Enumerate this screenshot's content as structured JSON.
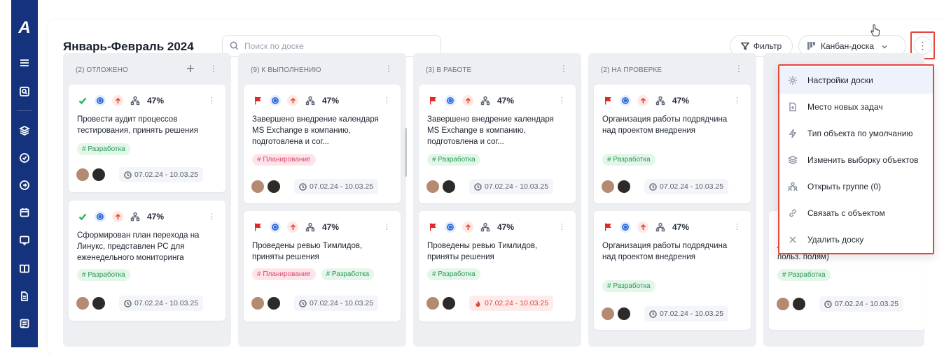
{
  "board": {
    "title": "Январь-Февраль 2024",
    "search_placeholder": "Поиск по доске",
    "filter_label": "Фильтр",
    "view_label": "Канбан-доска"
  },
  "columns": [
    {
      "header": "(2) ОТЛОЖЕНО",
      "cards": [
        {
          "status": "check",
          "percent": "47%",
          "title": "Провести аудит процессов тестирования, принять решения",
          "tags": [
            "# Разработка"
          ],
          "date": "07.02.24 - 10.03.25",
          "overdue": false
        },
        {
          "status": "check",
          "percent": "47%",
          "title": "Сформирован план перехода на Линукс, представлен PC для еженедельного мониторинга",
          "tags": [
            "# Разработка"
          ],
          "date": "07.02.24 - 10.03.25",
          "overdue": false
        }
      ]
    },
    {
      "header": "(9) К ВЫПОЛНЕНИЮ",
      "cards": [
        {
          "status": "flag",
          "percent": "47%",
          "title": "Завершено внедрение календаря MS Exchange в компанию, подготовлена и сог...",
          "tags": [
            "# Планирование"
          ],
          "date": "07.02.24 - 10.03.25",
          "overdue": false
        },
        {
          "status": "flag",
          "percent": "47%",
          "title": "Проведены ревью Тимлидов, приняты решения",
          "tags": [
            "# Планирование",
            "# Разработка"
          ],
          "date": "07.02.24 - 10.03.25",
          "overdue": false
        }
      ]
    },
    {
      "header": "(3) В РАБОТЕ",
      "cards": [
        {
          "status": "flag",
          "percent": "47%",
          "title": "Завершено внедрение календаря MS Exchange в компанию, подготовлена и сог...",
          "tags": [
            "# Разработка"
          ],
          "date": "07.02.24 - 10.03.25",
          "overdue": false
        },
        {
          "status": "flag",
          "percent": "47%",
          "title": "Проведены ревью Тимлидов, приняты решения",
          "tags": [
            "# Разработка"
          ],
          "date": "07.02.24 - 10.03.25",
          "overdue": true
        }
      ]
    },
    {
      "header": "(2) НА ПРОВЕРКЕ",
      "cards": [
        {
          "status": "flag",
          "percent": "47%",
          "title": "Организация работы подрядчина над проектом внедрения",
          "tags": [
            "# Разработка"
          ],
          "date": "07.02.24 - 10.03.25",
          "overdue": false
        },
        {
          "status": "flag",
          "percent": "47%",
          "title": "Организация работы подрядчина над проектом внедрения",
          "tags": [
            "# Разработка"
          ],
          "date": "07.02.24 - 10.03.25",
          "overdue": false
        }
      ]
    },
    {
      "header": "",
      "cards": [
        {
          "title": "АФЛ - Доработки Ганта (фильтры по польз. полям)",
          "tags": [
            "# Разработка"
          ],
          "date": "07.02.24 - 10.03.25",
          "overdue": false
        }
      ]
    }
  ],
  "menu": {
    "items": [
      {
        "label": "Настройки доски",
        "icon": "gear-icon"
      },
      {
        "label": "Место новых задач",
        "icon": "file-plus-icon"
      },
      {
        "label": "Тип объекта по умолчанию",
        "icon": "bolt-icon"
      },
      {
        "label": "Изменить выборку объектов",
        "icon": "layers-icon"
      },
      {
        "label": "Открыть группе (0)",
        "icon": "group-icon"
      },
      {
        "label": "Связать с объектом",
        "icon": "link-icon"
      },
      {
        "label": "Удалить доску",
        "icon": "close-icon"
      }
    ]
  },
  "colors": {
    "rail": "#15337d",
    "accent_red": "#e8453c",
    "tag_green": "#2a9a55",
    "tag_pink": "#d64a6b",
    "check_green": "#21b35a",
    "flag_red": "#e02a2a"
  }
}
